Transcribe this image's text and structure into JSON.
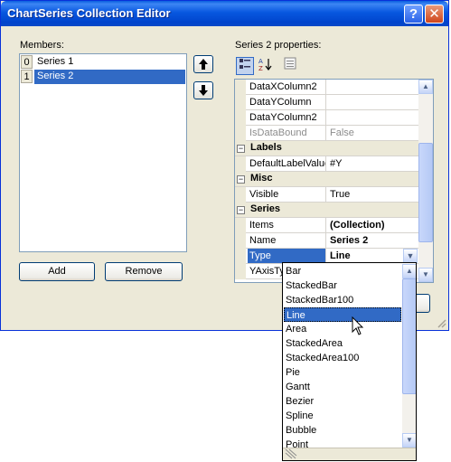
{
  "window": {
    "title": "ChartSeries Collection Editor",
    "help_glyph": "?",
    "close_glyph": "✕"
  },
  "members": {
    "label": "Members:",
    "items": [
      {
        "index": "0",
        "name": "Series 1"
      },
      {
        "index": "1",
        "name": "Series 2"
      }
    ],
    "add_label": "Add",
    "remove_label": "Remove"
  },
  "properties": {
    "label": "Series 2 properties:",
    "rows": [
      {
        "name": "DataXColumn2",
        "value": ""
      },
      {
        "name": "DataYColumn",
        "value": ""
      },
      {
        "name": "DataYColumn2",
        "value": ""
      },
      {
        "name": "IsDataBound",
        "value": "False"
      }
    ],
    "labels_category": "Labels",
    "labels_rows": [
      {
        "name": "DefaultLabelValue",
        "value": "#Y"
      }
    ],
    "misc_category": "Misc",
    "misc_rows": [
      {
        "name": "Visible",
        "value": "True"
      }
    ],
    "series_category": "Series",
    "series_rows": [
      {
        "name": "Items",
        "value": "(Collection)"
      },
      {
        "name": "Name",
        "value": "Series 2"
      },
      {
        "name": "Type",
        "value": "Line"
      },
      {
        "name": "YAxisType",
        "value": ""
      }
    ]
  },
  "type_dropdown": {
    "options": [
      "Bar",
      "StackedBar",
      "StackedBar100",
      "Line",
      "Area",
      "StackedArea",
      "StackedArea100",
      "Pie",
      "Gantt",
      "Bezier",
      "Spline",
      "Bubble",
      "Point"
    ],
    "selected": "Line"
  },
  "colors": {
    "selection": "#316ac5",
    "title_bar": "#0054e3",
    "dialog_bg": "#ece9d8"
  }
}
